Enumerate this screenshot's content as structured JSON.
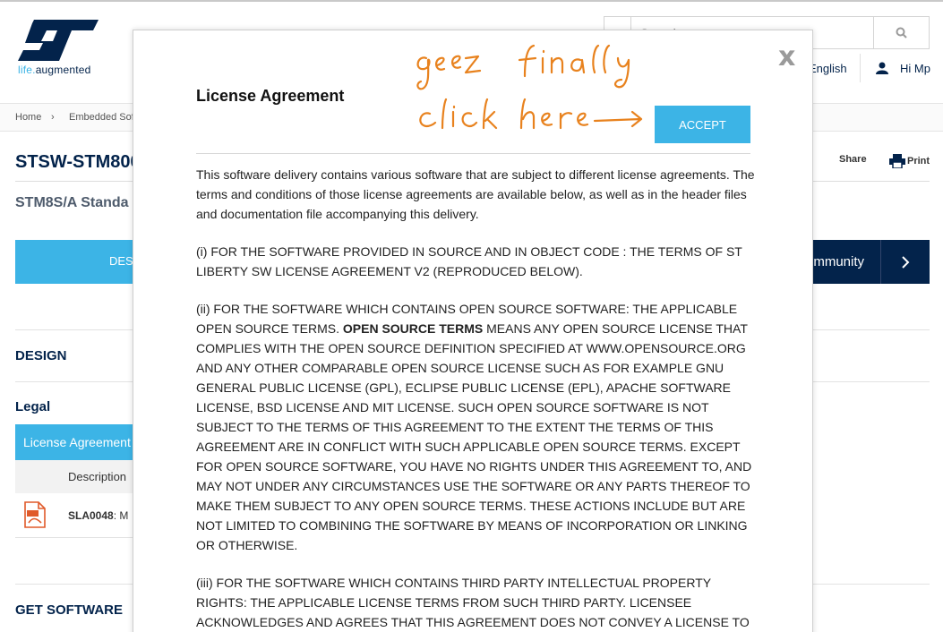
{
  "header": {
    "logo_text_colored": "life.",
    "logo_text_dark": "augmented",
    "search_placeholder": "Search",
    "language": "English",
    "user_greeting": "Hi Mp"
  },
  "breadcrumb": {
    "home": "Home",
    "separator": "›",
    "item1": "Embedded Sof"
  },
  "product": {
    "title": "STSW-STM800",
    "subtitle": "STM8S/A Standa",
    "share": "Share",
    "print": "Print"
  },
  "tabs": {
    "first": "DES",
    "community": "ommunity"
  },
  "sections": {
    "design": "DESIGN",
    "legal": "Legal",
    "license_header": "License Agreement",
    "description_header": "Description",
    "sla_code": "SLA0048",
    "sla_rest": ": M",
    "get_software": "GET SOFTWARE"
  },
  "modal": {
    "close": "x",
    "title": "License Agreement",
    "accept": "ACCEPT",
    "p1": "This software delivery contains various software that are subject to different license agreements. The terms and conditions of those license agreements are available below, as well as in the header files and documentation file accompanying this delivery.",
    "p2": "(i) FOR THE SOFTWARE PROVIDED IN SOURCE AND IN OBJECT CODE : THE TERMS OF ST LIBERTY SW LICENSE AGREEMENT V2 (REPRODUCED BELOW).",
    "p3_pre": "(ii) FOR THE SOFTWARE WHICH CONTAINS OPEN SOURCE SOFTWARE: THE APPLICABLE OPEN SOURCE TERMS. ",
    "p3_bold": "OPEN SOURCE TERMS",
    "p3_post": " MEANS ANY OPEN SOURCE LICENSE THAT COMPLIES WITH THE OPEN SOURCE DEFINITION SPECIFIED AT WWW.OPENSOURCE.ORG AND ANY OTHER COMPARABLE OPEN SOURCE LICENSE SUCH AS FOR EXAMPLE GNU GENERAL PUBLIC LICENSE (GPL), ECLIPSE PUBLIC LICENSE (EPL), APACHE SOFTWARE LICENSE, BSD LICENSE AND MIT LICENSE. SUCH OPEN SOURCE SOFTWARE IS NOT SUBJECT TO THE TERMS OF THIS AGREEMENT TO THE EXTENT THE TERMS OF THIS AGREEMENT ARE IN CONFLICT WITH SUCH APPLICABLE OPEN SOURCE TERMS. EXCEPT FOR OPEN SOURCE SOFTWARE, YOU HAVE NO RIGHTS UNDER THIS AGREEMENT TO, AND MAY NOT UNDER ANY CIRCUMSTANCES USE THE SOFTWARE OR ANY PARTS THEREOF TO MAKE THEM SUBJECT TO ANY OPEN SOURCE TERMS. THESE ACTIONS INCLUDE BUT ARE NOT LIMITED TO COMBINING THE SOFTWARE BY MEANS OF INCORPORATION OR LINKING OR OTHERWISE.",
    "p4": "(iii) FOR THE SOFTWARE WHICH CONTAINS THIRD PARTY INTELLECTUAL PROPERTY RIGHTS: THE APPLICABLE LICENSE TERMS FROM SUCH THIRD PARTY. LICENSEE ACKNOWLEDGES AND AGREES THAT THIS AGREEMENT DOES NOT CONVEY A LICENSE TO",
    "scribble_line1": "geez finally",
    "scribble_line2": "click here"
  },
  "colors": {
    "brand_dark": "#03234b",
    "brand_light": "#3cb4e6",
    "scribble": "#e8821e"
  }
}
